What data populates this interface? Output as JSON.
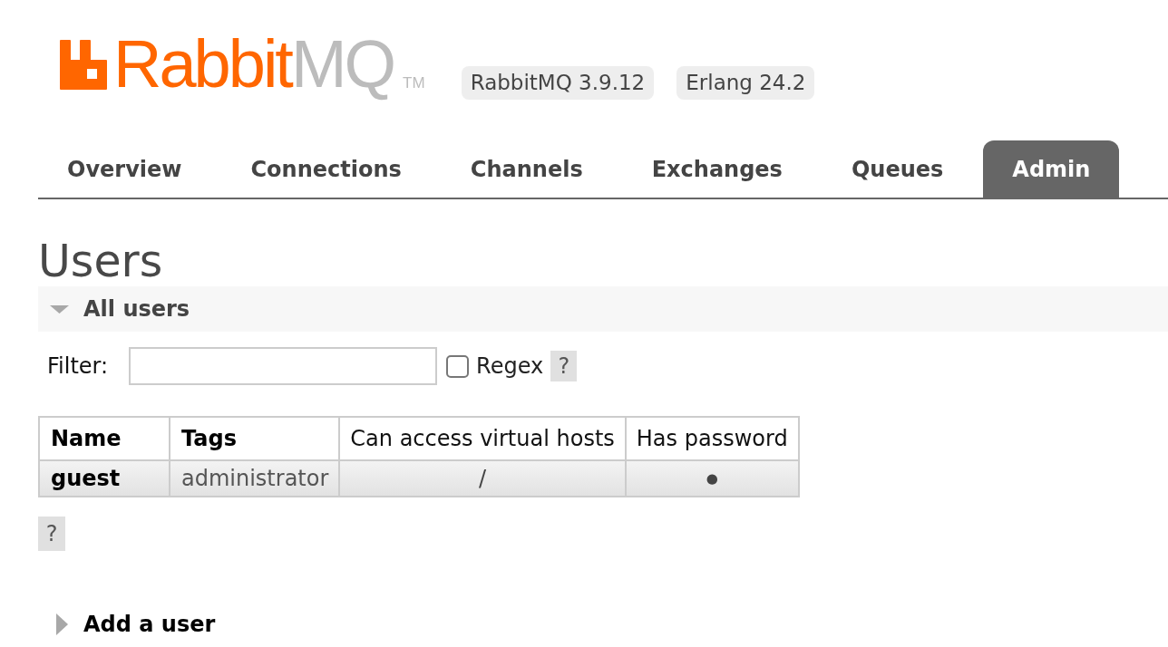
{
  "header": {
    "logo": {
      "wordmark": [
        "Rabbit",
        "MQ"
      ],
      "trademark": "TM"
    },
    "versions": [
      "RabbitMQ 3.9.12",
      "Erlang 24.2"
    ]
  },
  "tabs": [
    {
      "label": "Overview",
      "selected": false
    },
    {
      "label": "Connections",
      "selected": false
    },
    {
      "label": "Channels",
      "selected": false
    },
    {
      "label": "Exchanges",
      "selected": false
    },
    {
      "label": "Queues",
      "selected": false
    },
    {
      "label": "Admin",
      "selected": true
    }
  ],
  "page_title": "Users",
  "sections": [
    {
      "title": "All users",
      "expanded": true,
      "filter": {
        "label": "Filter:",
        "regex": {
          "label": "Regex",
          "checked": false
        },
        "help": "?"
      },
      "table": {
        "columns": [
          "Name",
          "Tags",
          "Can access virtual hosts",
          "Has password"
        ],
        "rows": [
          {
            "cells": [
              "guest",
              "administrator",
              "/",
              "●"
            ]
          }
        ]
      },
      "help": "?"
    },
    {
      "title": "Add a user",
      "expanded": false
    }
  ]
}
